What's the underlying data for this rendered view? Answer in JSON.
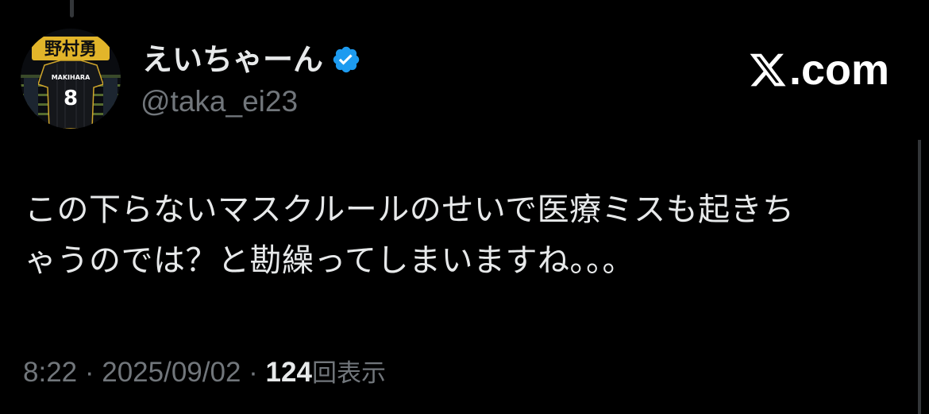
{
  "tweet": {
    "display_name": "えいちゃーん",
    "handle": "@taka_ei23",
    "verified": true,
    "verified_icon": "verified-badge-icon",
    "avatar": {
      "icon": "baseball-jersey-avatar",
      "banner_text": "野村勇",
      "jersey_name": "MAKIHARA",
      "jersey_number": "8"
    },
    "text_lines": [
      "この下らないマスクルールのせいで医療ミスも起きち",
      "ゃうのでは？と勘繰ってしまいますね。。。"
    ],
    "time": "8:22",
    "separator": "·",
    "date": "2025/09/02",
    "views_count": "124",
    "views_label": "回表示"
  },
  "brand": {
    "logo_icon": "x-logo-icon",
    "text": ".com"
  },
  "colors": {
    "background": "#000000",
    "primary_text": "#e7e9ea",
    "secondary_text": "#71767b",
    "verified_blue": "#1d9bf0"
  }
}
